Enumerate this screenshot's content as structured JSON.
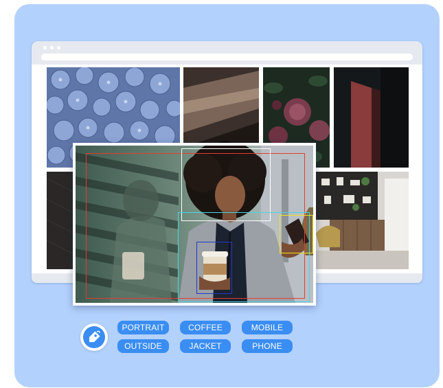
{
  "colors": {
    "background": "#b3d1fd",
    "accent": "#3a8df2",
    "box_red": "#e63b2e",
    "box_white": "#ffffff",
    "box_cyan": "#44d6e6",
    "box_blue": "#2536c9",
    "box_yellow": "#f2e31f"
  },
  "browser": {
    "gallery": [
      "hydrangea-flowers",
      "vintage-car",
      "dark-roses",
      "red-doorway",
      "dark-fabric",
      "shelving-interior",
      "white-kitchen"
    ]
  },
  "detection_photo": {
    "subject": "woman-with-coffee-and-phone",
    "boxes": [
      "red",
      "white",
      "cyan",
      "blue",
      "yellow"
    ]
  },
  "tags": {
    "icon": "tag-icon",
    "items": [
      "PORTRAIT",
      "COFFEE",
      "MOBILE",
      "OUTSIDE",
      "JACKET",
      "PHONE"
    ]
  }
}
